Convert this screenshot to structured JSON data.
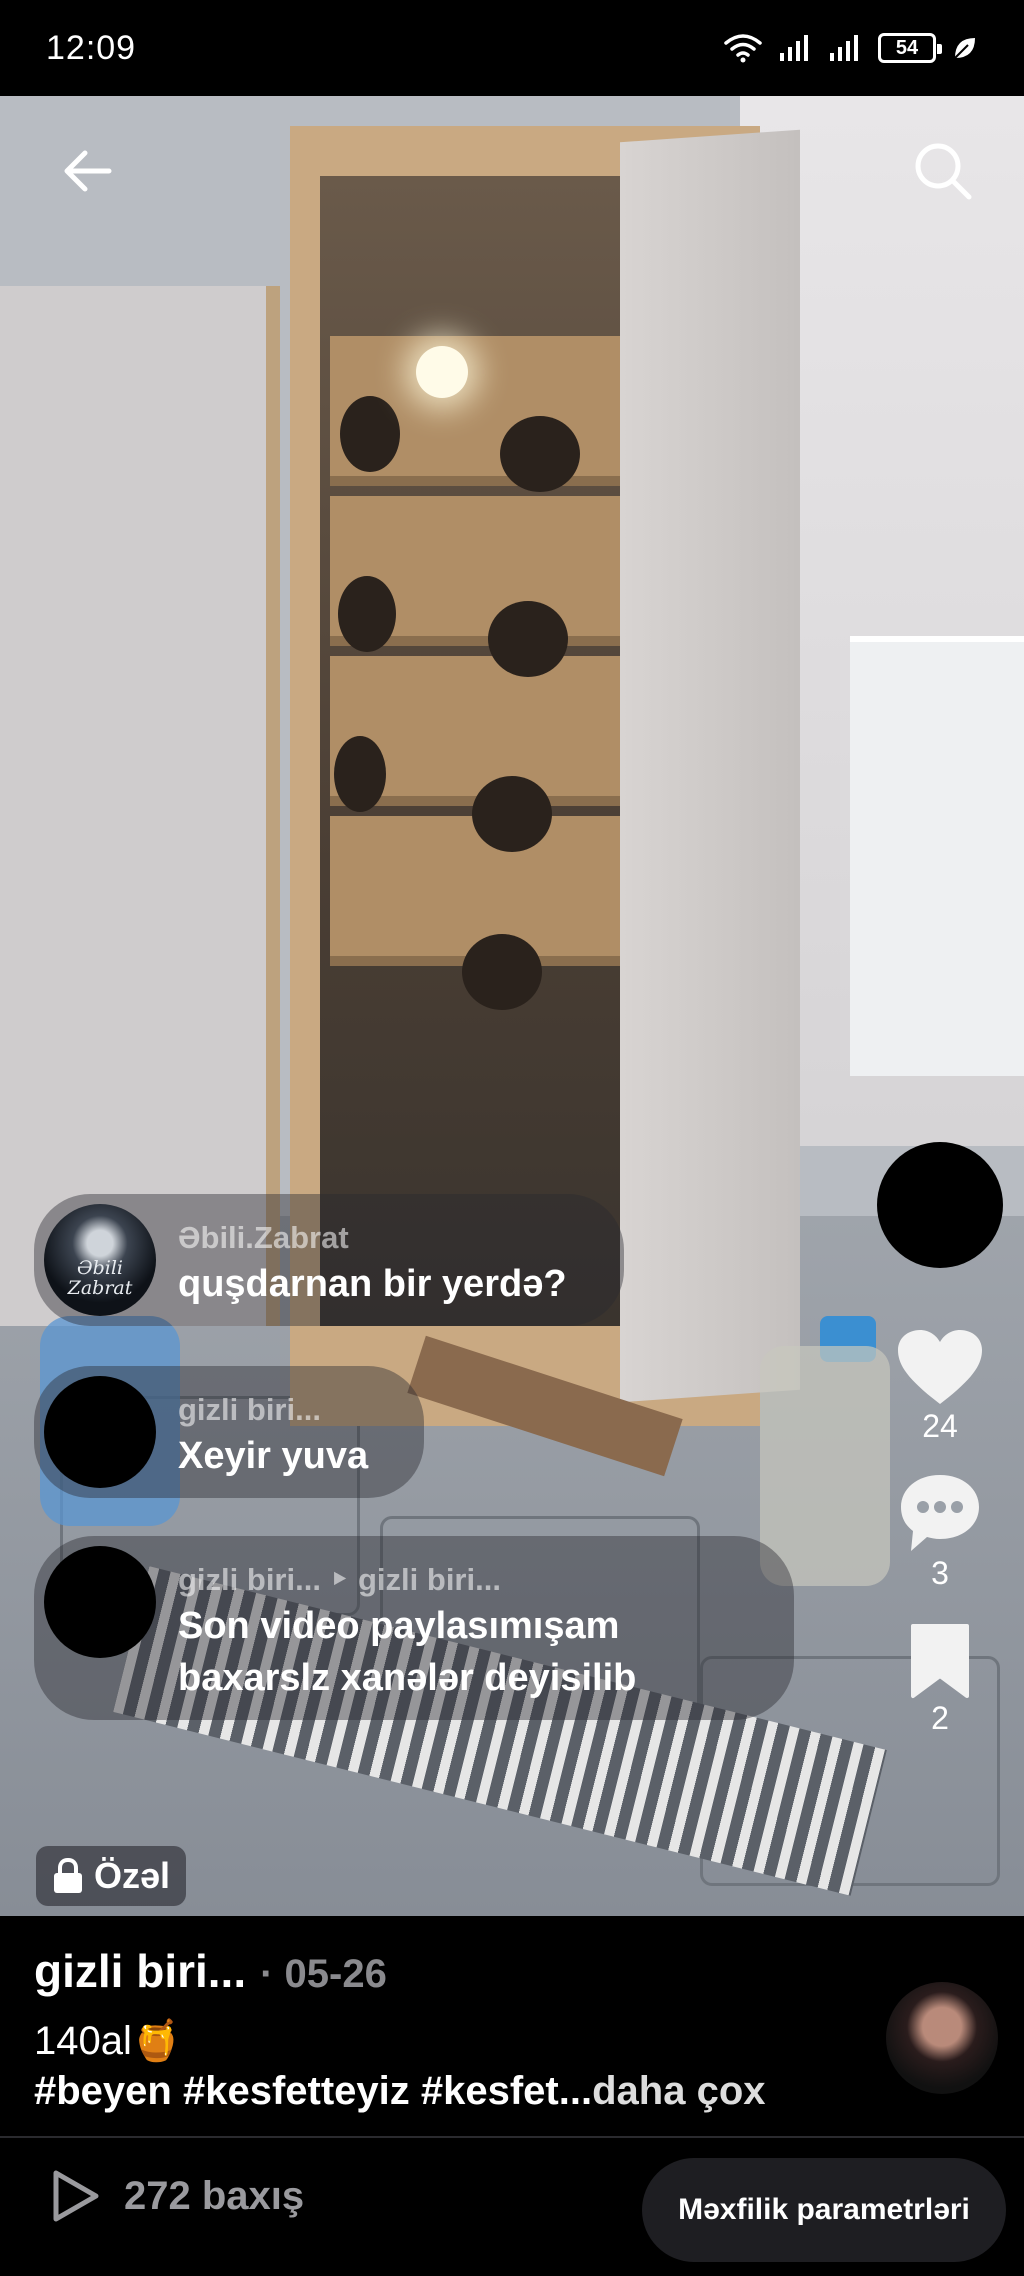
{
  "status_bar": {
    "time": "12:09",
    "battery": "54",
    "icons": [
      "wifi-icon",
      "signal-icon",
      "signal-icon",
      "battery-icon",
      "leaf-icon"
    ]
  },
  "video": {
    "icons": {
      "back": "arrow-left-icon",
      "search": "search-icon"
    }
  },
  "comments": [
    {
      "author": "Əbili.Zabrat",
      "text": "quşdarnan bir yerdə?",
      "avatar_text": "Əbili Zabrat"
    },
    {
      "author": "gizli biri...",
      "text": "Xeyir yuva"
    },
    {
      "author": "gizli biri... ‣ gizli biri...",
      "text_lines": [
        "Son video paylasımışam",
        "baxarslz xanələr deyisilib"
      ]
    }
  ],
  "actions": {
    "likes": "24",
    "comments": "3",
    "saves": "2"
  },
  "private_label": "Özəl",
  "post": {
    "username": "gizli biri...",
    "date": "· 05-26",
    "caption_line1": "140al🍯",
    "caption_line2": "#beyen #kesfetteyiz #kesfet...",
    "more_label": "daha çox"
  },
  "bottom_bar": {
    "views": "272 baxış",
    "privacy_button": "Məxfilik parametrləri"
  }
}
